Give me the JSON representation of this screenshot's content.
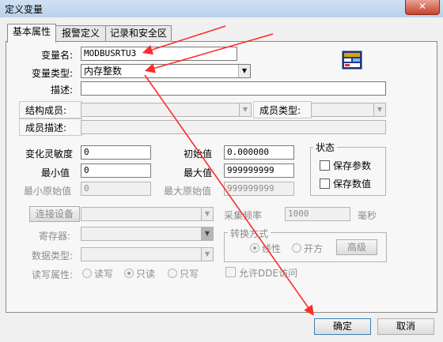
{
  "window": {
    "title": "定义变量",
    "close_glyph": "✕"
  },
  "tabs": [
    "基本属性",
    "报警定义",
    "记录和安全区"
  ],
  "fields": {
    "var_name_label": "变量名:",
    "var_name_value": "MODBUSRTU3",
    "var_type_label": "变量类型:",
    "var_type_value": "内存整数",
    "desc_label": "描述:",
    "desc_value": "",
    "struct_member_label": "结构成员:",
    "member_type_label": "成员类型:",
    "member_desc_label": "成员描述:",
    "sensitivity_label": "变化灵敏度",
    "sensitivity_value": "0",
    "init_label": "初始值",
    "init_value": "0.000000",
    "min_label": "最小值",
    "min_value": "0",
    "max_label": "最大值",
    "max_value": "999999999",
    "min_raw_label": "最小原始值",
    "min_raw_value": "0",
    "max_raw_label": "最大原始值",
    "max_raw_value": "999999999"
  },
  "state_group": {
    "title": "状态",
    "save_params_label": "保存参数",
    "save_values_label": "保存数值"
  },
  "io": {
    "connect_device_button": "连接设备",
    "register_label": "寄存器:",
    "data_type_label": "数据类型:",
    "rw_label": "读写属性:",
    "rw_options": [
      "读写",
      "只读",
      "只写"
    ],
    "rw_selected": "只读",
    "sample_freq_label": "采集频率",
    "sample_freq_value": "1000",
    "sample_freq_unit": "毫秒",
    "convert_group_title": "转换方式",
    "convert_options": [
      "线性",
      "开方"
    ],
    "convert_selected": "线性",
    "advanced_button": "高级",
    "allow_dde_label": "允许DDE访问"
  },
  "footer": {
    "ok_label": "确定",
    "cancel_label": "取消"
  },
  "colors": {
    "annotation_arrow": "#ff2a2a",
    "titlebar": "#b9d1ea",
    "close_button": "#c7422c"
  },
  "icons": [
    "close-icon",
    "dropdown-arrow-icon",
    "variable-icon"
  ]
}
